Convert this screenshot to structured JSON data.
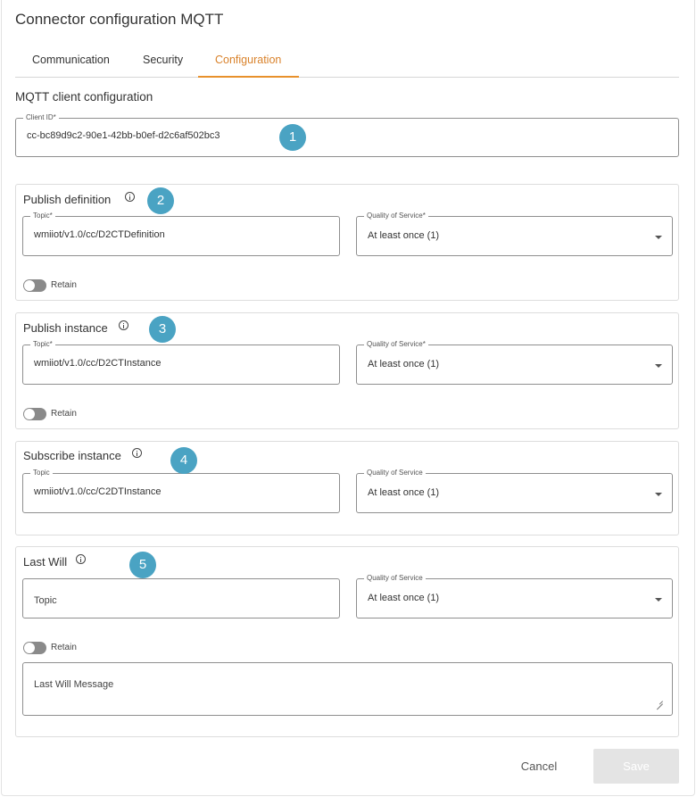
{
  "header": {
    "title": "Connector configuration MQTT"
  },
  "tabs": [
    {
      "label": "Communication"
    },
    {
      "label": "Security"
    },
    {
      "label": "Configuration"
    }
  ],
  "mqtt": {
    "section_title": "MQTT client configuration",
    "client_id": {
      "label": "Client ID*",
      "value": "cc-bc89d9c2-90e1-42bb-b0ef-d2c6af502bc3"
    }
  },
  "publish_definition": {
    "title": "Publish definition",
    "topic": {
      "label": "Topic*",
      "value": "wmiiot/v1.0/cc/D2CTDefinition"
    },
    "qos": {
      "label": "Quality of Service*",
      "value": "At least once (1)"
    },
    "retain_label": "Retain"
  },
  "publish_instance": {
    "title": "Publish instance",
    "topic": {
      "label": "Topic*",
      "value": "wmiiot/v1.0/cc/D2CTInstance"
    },
    "qos": {
      "label": "Quality of Service*",
      "value": "At least once (1)"
    },
    "retain_label": "Retain"
  },
  "subscribe_instance": {
    "title": "Subscribe instance",
    "topic": {
      "label": "Topic",
      "value": "wmiiot/v1.0/cc/C2DTInstance"
    },
    "qos": {
      "label": "Quality of Service",
      "value": "At least once (1)"
    }
  },
  "last_will": {
    "title": "Last Will",
    "topic": {
      "placeholder": "Topic"
    },
    "qos": {
      "label": "Quality of Service",
      "value": "At least once (1)"
    },
    "retain_label": "Retain",
    "message": {
      "placeholder": "Last Will Message"
    }
  },
  "badges": [
    "1",
    "2",
    "3",
    "4",
    "5"
  ],
  "footer": {
    "cancel_label": "Cancel",
    "save_label": "Save"
  },
  "colors": {
    "accent": "#e8912c",
    "badge": "#4aa3c3",
    "toggle_off": "#8a8a8a",
    "save_disabled": "#e4e4e4"
  }
}
